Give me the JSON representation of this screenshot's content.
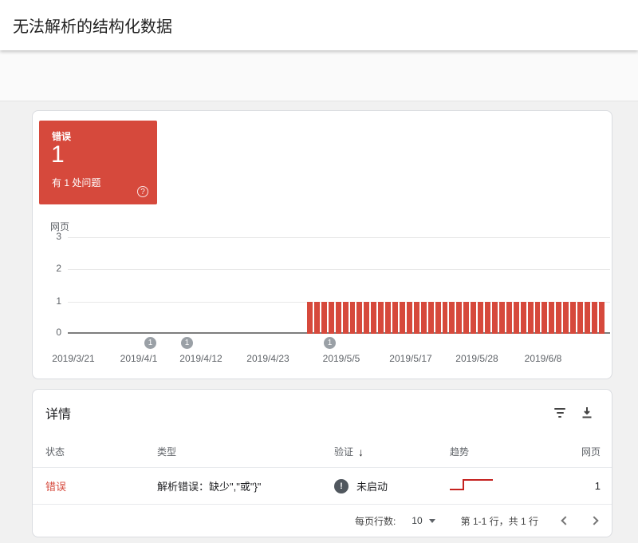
{
  "page": {
    "title": "无法解析的结构化数据"
  },
  "colors": {
    "error_red": "#d6493c",
    "sparkline_red": "#c5221f",
    "annotation_gray": "#9aa0a6"
  },
  "summary_card": {
    "label": "错误",
    "count": "1",
    "subtext": "有 1 处问题",
    "help_glyph": "?"
  },
  "chart_data": {
    "type": "bar",
    "title": "",
    "xlabel": "",
    "ylabel": "网页",
    "ylim": [
      0,
      3
    ],
    "grid": true,
    "legend": "none",
    "yticks": [
      "3",
      "2",
      "1",
      "0"
    ],
    "x_axis_labels": [
      "2019/3/21",
      "2019/4/1",
      "2019/4/12",
      "2019/4/23",
      "2019/5/5",
      "2019/5/17",
      "2019/5/28",
      "2019/6/8"
    ],
    "series": [
      {
        "name": "错误",
        "bar_count": 42,
        "bar_value": 1,
        "color": "#d6493c"
      }
    ],
    "axis_annotations": [
      {
        "label": "1",
        "near": "2019/4/1"
      },
      {
        "label": "1",
        "near": "2019/4/7"
      },
      {
        "label": "1",
        "near": "2019/5/5"
      }
    ]
  },
  "details": {
    "title": "详情",
    "columns": {
      "status": "状态",
      "type": "类型",
      "validation": "验证",
      "trend": "趋势",
      "pages": "网页"
    },
    "sort_icon": "↓",
    "rows": [
      {
        "status": "错误",
        "type": "解析错误：缺少\",\"或\"}\"",
        "validation_icon": "!",
        "validation": "未启动",
        "pages": "1"
      }
    ],
    "pagination": {
      "rows_per_page_label": "每页行数:",
      "rows_per_page_value": "10",
      "range_label": "第 1-1 行，共 1 行"
    }
  }
}
